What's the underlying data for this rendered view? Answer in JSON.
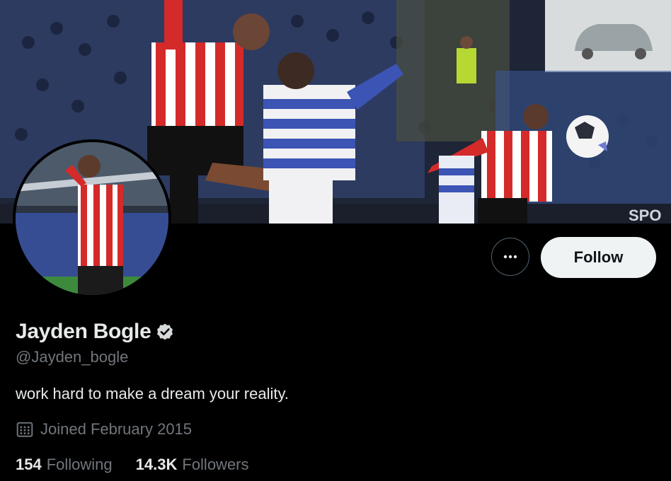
{
  "profile": {
    "display_name": "Jayden Bogle",
    "handle": "@Jayden_bogle",
    "verified": true,
    "bio": "work hard to make a dream your reality.",
    "joined": "Joined February 2015",
    "following_count": "154",
    "following_label": "Following",
    "followers_count": "14.3K",
    "followers_label": "Followers"
  },
  "actions": {
    "follow_label": "Follow",
    "more_icon": "more-horizontal-icon"
  },
  "banner": {
    "ad_board_text": "SPO"
  },
  "colors": {
    "background": "#000000",
    "primary_text": "#e7e9ea",
    "secondary_text": "#71767b",
    "follow_button_bg": "#eff3f4",
    "follow_button_text": "#0f1419",
    "border": "#536471"
  }
}
